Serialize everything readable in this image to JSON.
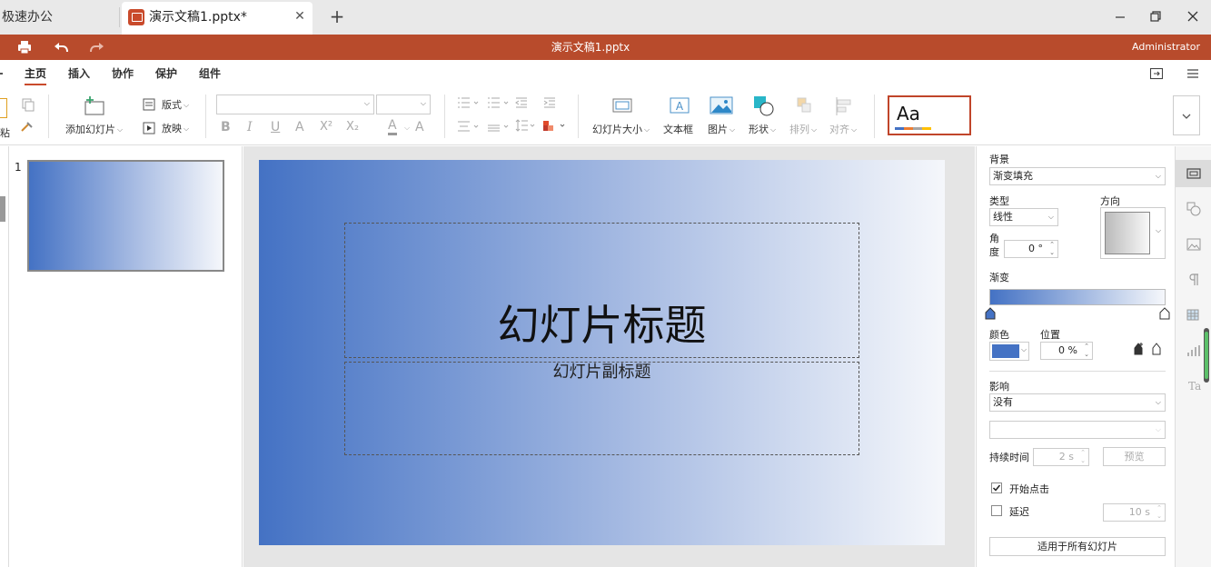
{
  "tabs": {
    "other": "极速办公",
    "active": "演示文稿1.pptx*",
    "close_icon": "close-icon",
    "new_tab_icon": "plus-icon"
  },
  "titlebar": {
    "title": "演示文稿1.pptx",
    "user": "Administrator",
    "color": "#b84b2c"
  },
  "menu": {
    "items": [
      "主页",
      "插入",
      "协作",
      "保护",
      "组件"
    ],
    "active": "主页"
  },
  "toolbar": {
    "paste_label": "粘",
    "add_slide": "添加幻灯片",
    "layout": "版式",
    "play": "放映",
    "bold": "B",
    "italic": "I",
    "underline": "U",
    "strike": "A",
    "superscript": "X²",
    "subscript": "X₂",
    "font_color": "A",
    "clear_format": "A",
    "slide_size": "幻灯片大小",
    "textbox": "文本框",
    "picture": "图片",
    "shape": "形状",
    "arrange": "排列",
    "align": "对齐",
    "theme_preview": "Aa"
  },
  "thumbnails": {
    "items": [
      {
        "number": "1"
      }
    ]
  },
  "slide": {
    "title": "幻灯片标题",
    "subtitle": "幻灯片副标题",
    "gradient_start": "#4472c4",
    "gradient_end": "#f5f7fb"
  },
  "panel": {
    "background_label": "背景",
    "background_value": "渐变填充",
    "type_label": "类型",
    "type_value": "线性",
    "direction_label": "方向",
    "angle_label_1": "角",
    "angle_label_2": "度",
    "angle_value": "0 °",
    "gradient_label": "渐变",
    "color_label": "颜色",
    "position_label": "位置",
    "position_value": "0 %",
    "color_swatch": "#4472c4",
    "effect_label": "影响",
    "effect_value": "没有",
    "duration_label": "持续时间",
    "duration_value": "2 s",
    "preview_button": "预览",
    "start_on_click": "开始点击",
    "start_on_click_checked": true,
    "delay": "延迟",
    "delay_checked": false,
    "delay_value": "10 s",
    "apply_all": "适用于所有幻灯片"
  },
  "sidebar": {
    "icons": [
      "slide-settings-icon",
      "shape-settings-icon",
      "image-settings-icon",
      "paragraph-settings-icon",
      "table-settings-icon",
      "chart-settings-icon",
      "text-art-settings-icon"
    ]
  }
}
